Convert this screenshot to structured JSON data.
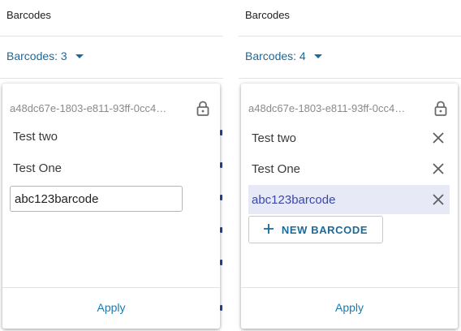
{
  "left": {
    "header_title": "Barcodes",
    "selector_label": "Barcodes: 3",
    "id_text": "a48dc67e-1803-e811-93ff-0cc4…",
    "items": [
      "Test two",
      "Test One"
    ],
    "input_value": "abc123barcode",
    "apply_label": "Apply"
  },
  "right": {
    "header_title": "Barcodes",
    "selector_label": "Barcodes: 4",
    "id_text": "a48dc67e-1803-e811-93ff-0cc4…",
    "items": [
      "Test two",
      "Test One",
      "abc123barcode"
    ],
    "selected_item": "abc123barcode",
    "new_button_label": "NEW BARCODE",
    "apply_label": "Apply"
  },
  "icons": {
    "lock": "lock-icon",
    "close": "close-icon",
    "plus": "plus-icon",
    "caret": "caret-down-icon"
  },
  "colors": {
    "accent": "#1a6a9a",
    "selected_bg": "#e7e9f7",
    "selected_text": "#3949ab"
  }
}
